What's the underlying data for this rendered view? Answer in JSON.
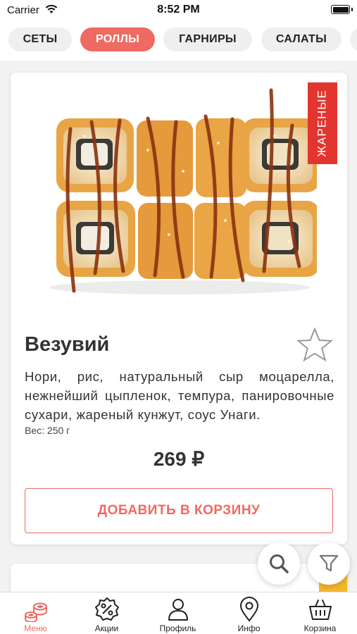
{
  "status_bar": {
    "carrier": "Carrier",
    "time": "8:52 PM"
  },
  "categories": [
    {
      "label": "СЕТЫ",
      "active": false
    },
    {
      "label": "РОЛЛЫ",
      "active": true
    },
    {
      "label": "ГАРНИРЫ",
      "active": false
    },
    {
      "label": "САЛАТЫ",
      "active": false
    }
  ],
  "product": {
    "badge": "ЖАРЕНЫЕ",
    "title": "Везувий",
    "description": "Нори, рис, натуральный сыр моцарелла, нежнейший цыпленок, темпура, панировочные сухари, жареный кунжут, соус Унаги.",
    "weight": "Вес: 250 г",
    "price": "269 ₽",
    "add_button": "ДОБАВИТЬ В КОРЗИНУ"
  },
  "tabs": [
    {
      "label": "Меню",
      "icon": "sushi-icon",
      "active": true
    },
    {
      "label": "Акции",
      "icon": "discount-icon",
      "active": false
    },
    {
      "label": "Профиль",
      "icon": "profile-icon",
      "active": false
    },
    {
      "label": "Инфо",
      "icon": "location-pin-icon",
      "active": false
    },
    {
      "label": "Корзина",
      "icon": "basket-icon",
      "active": false
    }
  ],
  "colors": {
    "accent": "#ef6a62",
    "badge": "#e3352f"
  }
}
